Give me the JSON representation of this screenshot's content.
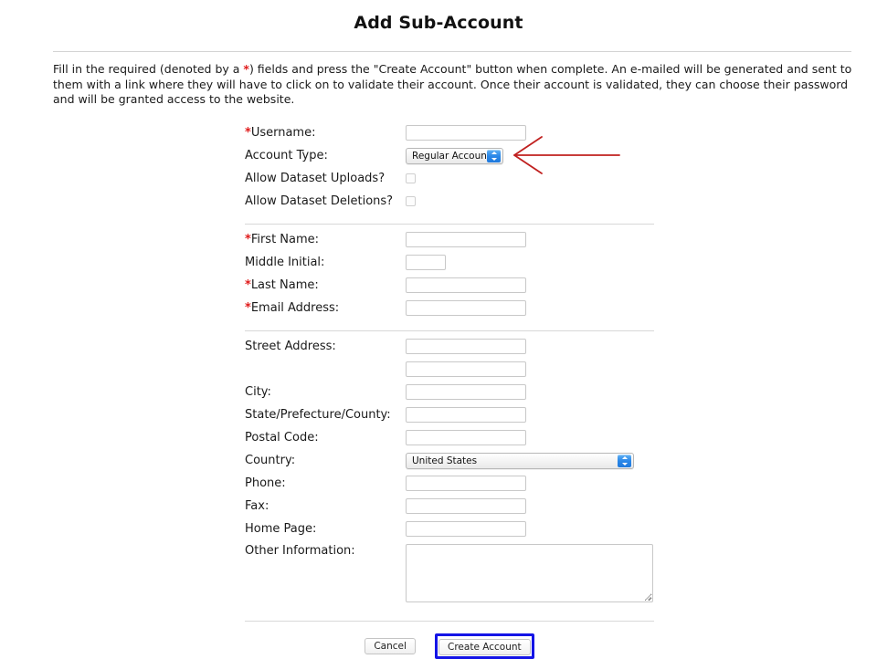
{
  "page": {
    "title": "Add Sub-Account",
    "intro_before_star": "Fill in the required (denoted by a ",
    "intro_star": "*",
    "intro_after_star": ") fields and press the \"Create Account\" button when complete. An e-mailed will be generated and sent to them with a link where they will have to click on to validate their account. Once their account is validated, they can choose their password and will be granted access to the website."
  },
  "accent": {
    "required_star_color": "#e01b1b",
    "annotation_arrow_color": "#c0201f",
    "focus_box_color": "#1414e6",
    "select_stepper_color": "#2a87e8"
  },
  "section_account": {
    "username": {
      "star": "*",
      "label": "Username:",
      "value": "",
      "placeholder": ""
    },
    "account_type": {
      "label": "Account Type:",
      "selected": "Regular Account",
      "options": [
        "Regular Account"
      ]
    },
    "allow_uploads": {
      "label": "Allow Dataset Uploads?",
      "checked": false
    },
    "allow_deletions": {
      "label": "Allow Dataset Deletions?",
      "checked": false
    }
  },
  "section_name": {
    "first_name": {
      "star": "*",
      "label": "First Name:",
      "value": "",
      "placeholder": ""
    },
    "middle_initial": {
      "label": "Middle Initial:",
      "value": "",
      "placeholder": ""
    },
    "last_name": {
      "star": "*",
      "label": "Last Name:",
      "value": "",
      "placeholder": ""
    },
    "email": {
      "star": "*",
      "label": "Email Address:",
      "value": "",
      "placeholder": ""
    }
  },
  "section_address": {
    "street": {
      "label": "Street Address:",
      "value": "",
      "placeholder": ""
    },
    "street2": {
      "label": "",
      "value": "",
      "placeholder": ""
    },
    "city": {
      "label": "City:",
      "value": "",
      "placeholder": ""
    },
    "state": {
      "label": "State/Prefecture/County:",
      "value": "",
      "placeholder": ""
    },
    "postal": {
      "label": "Postal Code:",
      "value": "",
      "placeholder": ""
    },
    "country": {
      "label": "Country:",
      "selected": "United States",
      "options": [
        "United States"
      ]
    },
    "phone": {
      "label": "Phone:",
      "value": "",
      "placeholder": ""
    },
    "fax": {
      "label": "Fax:",
      "value": "",
      "placeholder": ""
    },
    "home_page": {
      "label": "Home Page:",
      "value": "",
      "placeholder": ""
    },
    "other_info": {
      "label": "Other Information:",
      "value": "",
      "placeholder": ""
    }
  },
  "actions": {
    "cancel_label": "Cancel",
    "create_label": "Create Account"
  }
}
